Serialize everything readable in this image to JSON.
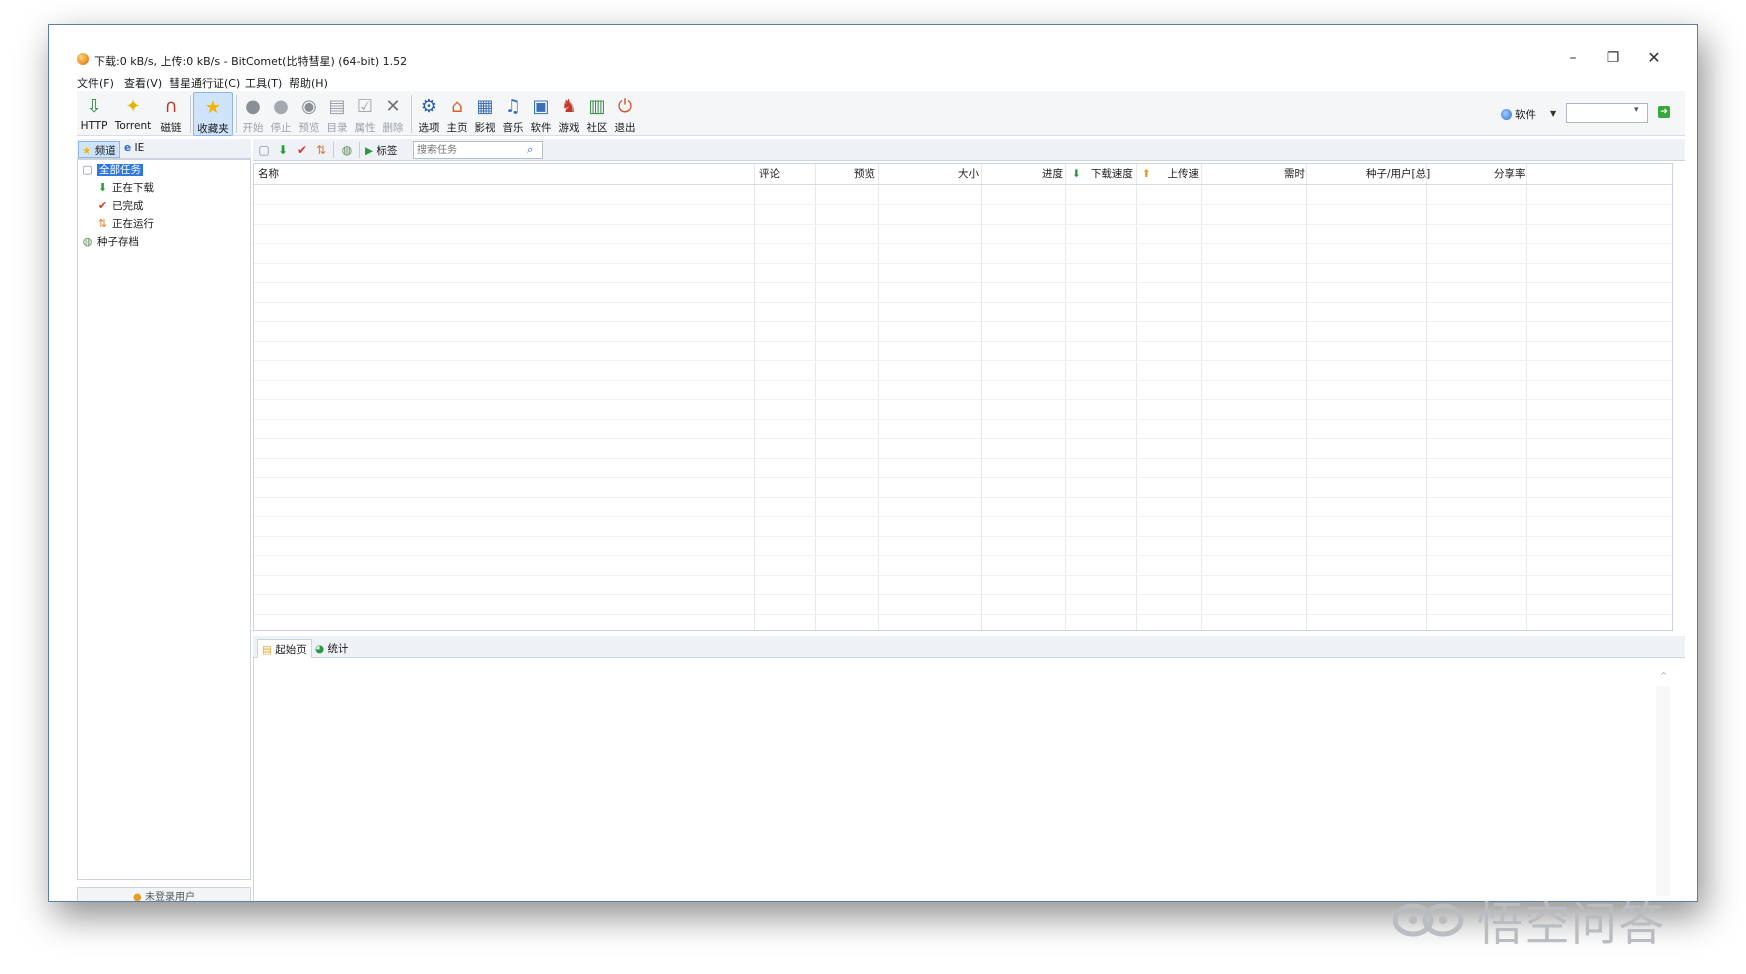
{
  "window": {
    "title": "下载:0 kB/s, 上传:0 kB/s - BitComet(比特彗星) (64-bit) 1.52",
    "min": "–",
    "max": "❐",
    "close": "✕"
  },
  "menu": [
    "文件(F)",
    "查看(V)",
    "彗星通行证(C)",
    "工具(T)",
    "帮助(H)"
  ],
  "toolbar": {
    "buttons": [
      {
        "label": "HTTP",
        "icon": "http-download-icon",
        "glyph": "⇩",
        "color": "#2b8a3e"
      },
      {
        "label": "Torrent",
        "icon": "torrent-icon",
        "glyph": "✦",
        "color": "#e3b400"
      },
      {
        "label": "磁链",
        "icon": "magnet-icon",
        "glyph": "∩",
        "color": "#c0392b"
      },
      {
        "label": "收藏夹",
        "icon": "favorites-star-icon",
        "glyph": "★",
        "color": "#f2b400"
      },
      {
        "label": "开始",
        "icon": "start-icon",
        "glyph": "●",
        "color": "#8a8f96"
      },
      {
        "label": "停止",
        "icon": "stop-icon",
        "glyph": "●",
        "color": "#a4a9b0"
      },
      {
        "label": "预览",
        "icon": "preview-icon",
        "glyph": "◉",
        "color": "#8a8f96"
      },
      {
        "label": "目录",
        "icon": "folder-icon",
        "glyph": "▤",
        "color": "#9aa0a8"
      },
      {
        "label": "属性",
        "icon": "properties-icon",
        "glyph": "☑",
        "color": "#a4a9b0"
      },
      {
        "label": "删除",
        "icon": "delete-icon",
        "glyph": "✕",
        "color": "#6f747b"
      },
      {
        "label": "选项",
        "icon": "options-icon",
        "glyph": "⚙",
        "color": "#2c5fa8"
      },
      {
        "label": "主页",
        "icon": "home-icon",
        "glyph": "⌂",
        "color": "#d9622b"
      },
      {
        "label": "影视",
        "icon": "video-icon",
        "glyph": "▦",
        "color": "#3a6fb7"
      },
      {
        "label": "音乐",
        "icon": "music-icon",
        "glyph": "♫",
        "color": "#3a6fb7"
      },
      {
        "label": "软件",
        "icon": "software-icon",
        "glyph": "▣",
        "color": "#3a6fb7"
      },
      {
        "label": "游戏",
        "icon": "game-icon",
        "glyph": "♞",
        "color": "#c0392b"
      },
      {
        "label": "社区",
        "icon": "community-icon",
        "glyph": "▥",
        "color": "#3a8a4a"
      },
      {
        "label": "退出",
        "icon": "exit-icon",
        "glyph": "⏻",
        "color": "#d9522b"
      }
    ],
    "search_scope": "软件",
    "scope_value": ""
  },
  "left_tabs": [
    "频道",
    "IE"
  ],
  "tree": [
    {
      "label": "全部任务",
      "icon": "all-tasks-icon",
      "glyph": "▢",
      "color": "#7a8ea8",
      "selected": true
    },
    {
      "label": "正在下载",
      "icon": "downloading-icon",
      "glyph": "⬇",
      "color": "#2b9a3e"
    },
    {
      "label": "已完成",
      "icon": "completed-icon",
      "glyph": "✔",
      "color": "#d23a2b"
    },
    {
      "label": "正在运行",
      "icon": "running-icon",
      "glyph": "⇅",
      "color": "#e0782b"
    },
    {
      "label": "种子存档",
      "icon": "torrent-archive-icon",
      "glyph": "◍",
      "color": "#5a8a5a"
    }
  ],
  "left_bottom": "未登录用户",
  "task_toolbar": {
    "tag_label": "标签",
    "search_placeholder": "搜索任务"
  },
  "columns": [
    "名称",
    "评论",
    "预览",
    "大小",
    "进度",
    "下载速度",
    "上传速",
    "需时",
    "种子/用户[总]",
    "分享率"
  ],
  "bottom_tabs": [
    "起始页",
    "统计"
  ],
  "watermark": "悟空问答"
}
